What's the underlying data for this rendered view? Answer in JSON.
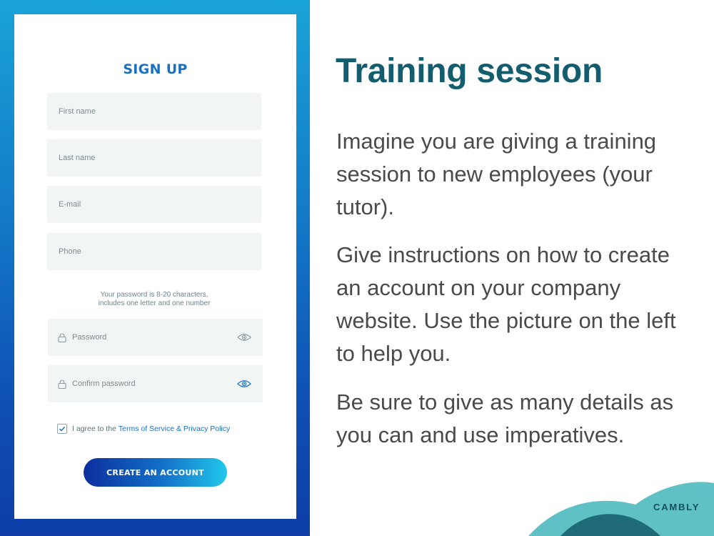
{
  "form": {
    "title": "SIGN UP",
    "fields": {
      "first_name": {
        "placeholder": "First name"
      },
      "last_name": {
        "placeholder": "Last name"
      },
      "email": {
        "placeholder": "E-mail"
      },
      "phone": {
        "placeholder": "Phone"
      },
      "password": {
        "placeholder": "Password",
        "icon": "lock-icon",
        "toggle_icon": "eye-icon"
      },
      "confirm_password": {
        "placeholder": "Confirm password",
        "icon": "lock-icon",
        "toggle_icon": "eye-icon"
      }
    },
    "password_hint_line1": "Your password is 8-20 characters,",
    "password_hint_line2": "includes one letter and one number",
    "agree": {
      "checked": true,
      "text": "I agree to the",
      "link_text": "Terms of Service & Privacy Policy"
    },
    "submit_label": "CREATE AN ACCOUNT"
  },
  "slide": {
    "heading": "Training session",
    "paragraphs": [
      "Imagine you are giving a training session to new employees (your tutor).",
      "Give instructions on how to create an account on your company website. Use the picture on the left to help you.",
      "Be sure to give as many details as you can and use imperatives."
    ],
    "brand": "CAMBLY"
  },
  "colors": {
    "heading": "#145d6e",
    "body_text": "#4a4a4a",
    "form_title": "#1a6fbf",
    "panel_top": "#1aa3d6",
    "panel_bottom": "#0f3ea8",
    "field_bg": "#f1f6f5",
    "button_start": "#0c2f9e",
    "button_end": "#22c8ec",
    "decor_teal": "#5fc1c6",
    "decor_dark": "#1f6a78"
  }
}
